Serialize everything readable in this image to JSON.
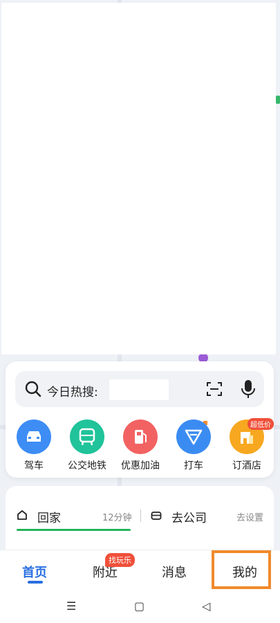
{
  "search": {
    "prompt": "今日热搜:"
  },
  "shortcuts": [
    {
      "label": "驾车",
      "color": "#3d8df5",
      "icon": "car-icon"
    },
    {
      "label": "公交地铁",
      "color": "#20c39a",
      "icon": "bus-icon"
    },
    {
      "label": "优惠加油",
      "color": "#f26262",
      "icon": "fuel-icon"
    },
    {
      "label": "打车",
      "color": "#3b8cf2",
      "icon": "taxi-icon"
    },
    {
      "label": "订酒店",
      "color": "#f7a820",
      "icon": "hotel-icon",
      "badge": "超低价"
    }
  ],
  "places": {
    "home": "回家",
    "home_time": "12分钟",
    "work": "去公司",
    "setting": "去设置"
  },
  "nav": {
    "home": "首页",
    "nearby": "附近",
    "nearby_badge": "找玩乐",
    "messages": "消息",
    "mine": "我的"
  },
  "system": {
    "menu": "☰",
    "home": "▢",
    "back": "◁"
  },
  "colors": {
    "accent": "#2a6fe0",
    "highlight": "#f08a2c",
    "route_green": "#24b35a"
  }
}
